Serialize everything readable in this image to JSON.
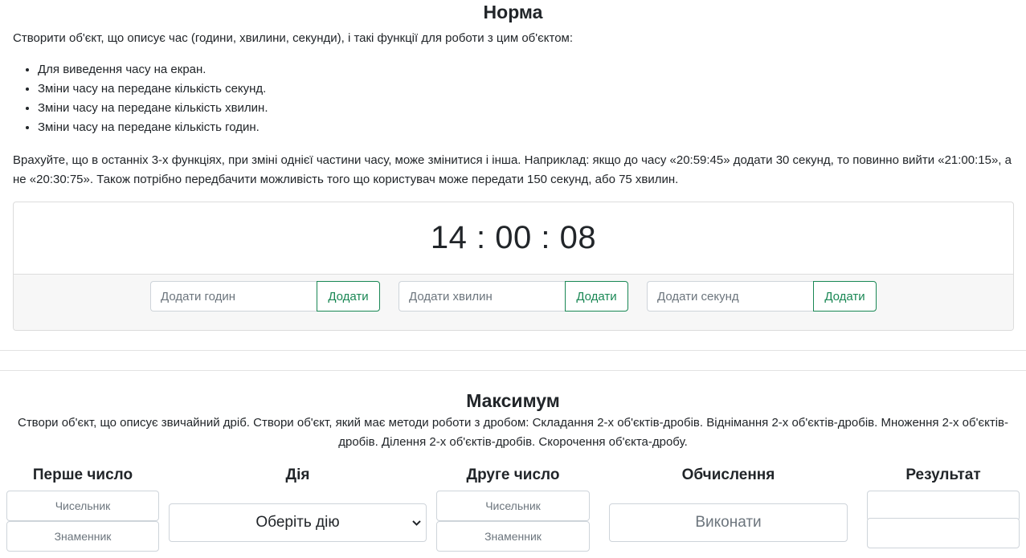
{
  "norma": {
    "title": "Норма",
    "description": "Створити об'єкт, що описує час (години, хвилини, секунди), і такі функції для роботи з цим об'єктом:",
    "list": [
      "Для виведення часу на екран.",
      "Зміни часу на передане кількість секунд.",
      "Зміни часу на передане кількість хвилин.",
      "Зміни часу на передане кількість годин."
    ],
    "note": "Врахуйте, що в останніх 3-х функціях, при зміні однієї частини часу, може змінитися і інша. Наприклад: якщо до часу «20:59:45» додати 30 секунд, то повинно вийти «21:00:15», а не «20:30:75». Також потрібно передбачити можливість того що користувач може передати 150 секунд, або 75 хвилин.",
    "clock": "14 : 00 : 08",
    "add_hours": {
      "placeholder": "Додати годин",
      "button": "Додати"
    },
    "add_minutes": {
      "placeholder": "Додати хвилин",
      "button": "Додати"
    },
    "add_seconds": {
      "placeholder": "Додати секунд",
      "button": "Додати"
    }
  },
  "maximum": {
    "title": "Максимум",
    "description": "Створи об'єкт, що описує звичайний дріб. Створи об'єкт, який має методи роботи з дробом: Складання 2-х об'єктів-дробів. Віднімання 2-х об'єктів-дробів. Множення 2-х об'єктів-дробів. Ділення 2-х об'єктів-дробів. Скорочення об'єкта-дробу.",
    "columns": {
      "first": "Перше число",
      "action": "Дія",
      "second": "Друге число",
      "compute": "Обчислення",
      "result": "Результат"
    },
    "first": {
      "numerator_placeholder": "Чисельник",
      "denominator_placeholder": "Знаменник"
    },
    "second": {
      "numerator_placeholder": "Чисельник",
      "denominator_placeholder": "Знаменник"
    },
    "action_select": {
      "selected": "Оберіть дію",
      "arrow_icon": "chevron-down-icon"
    },
    "run_button": "Виконати"
  }
}
